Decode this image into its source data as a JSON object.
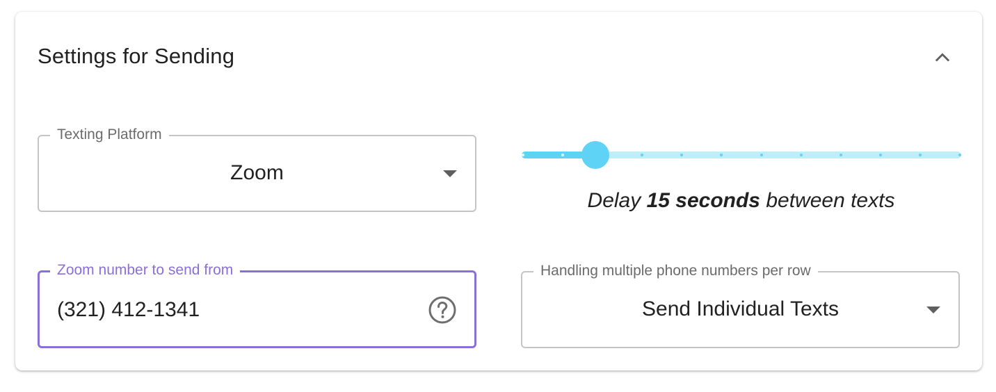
{
  "card": {
    "title": "Settings for Sending"
  },
  "platform_select": {
    "label": "Texting Platform",
    "value": "Zoom"
  },
  "delay_slider": {
    "value_seconds": 15,
    "prefix": "Delay",
    "value_label": "15 seconds",
    "suffix": "between texts",
    "fraction": 0.166,
    "marks": 12,
    "color": "#5fd3f6"
  },
  "zoom_number_field": {
    "label": "Zoom number to send from",
    "value": "(321) 412-1341",
    "accent_color": "#8b6fd8"
  },
  "multi_number_select": {
    "label": "Handling multiple phone numbers per row",
    "value": "Send Individual Texts"
  },
  "icons": {
    "collapse": "chevron-up-icon",
    "help": "help-circle-icon",
    "dropdown": "caret-down-icon"
  }
}
